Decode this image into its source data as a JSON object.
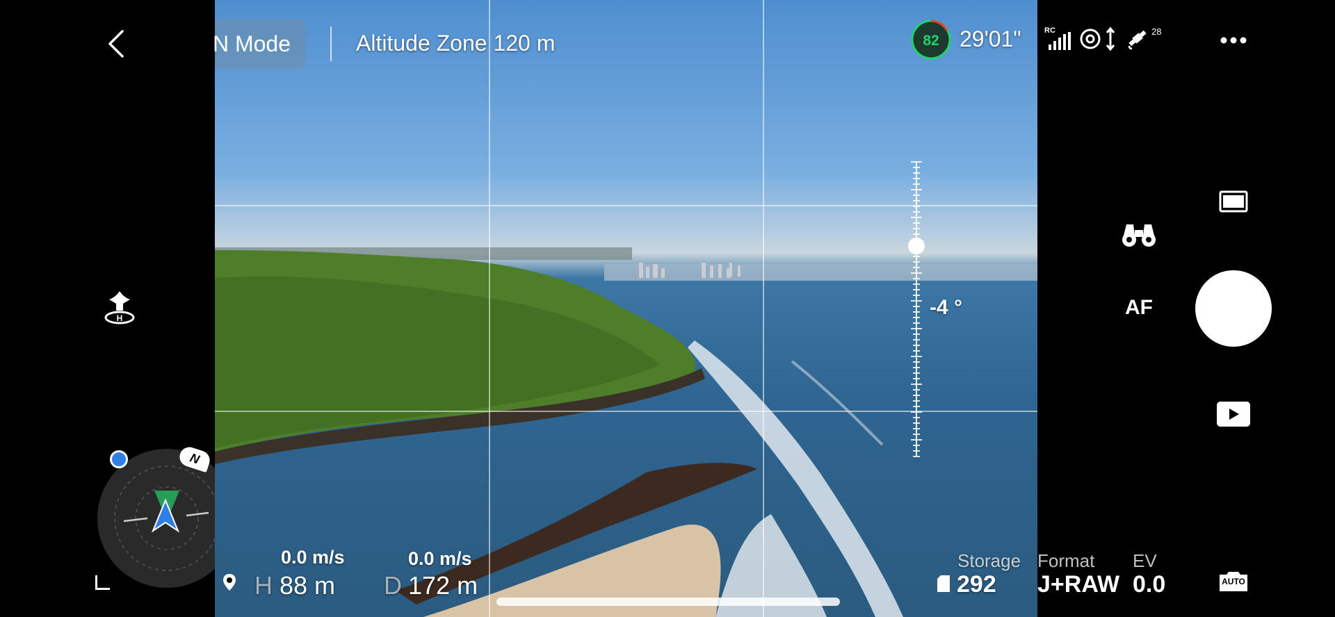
{
  "top_bar": {
    "mode_label": "N Mode",
    "altitude_zone": "Altitude Zone 120 m",
    "battery_percent": "82",
    "flight_time": "29'01\"",
    "rc_label": "RC",
    "satellite_count": "28"
  },
  "gimbal": {
    "angle_label": "-4 °"
  },
  "right_controls": {
    "af_label": "AF",
    "auto_label": "AUTO"
  },
  "telemetry": {
    "vertical_speed": "0.0 m/s",
    "horizontal_speed": "0.0 m/s",
    "height_prefix": "H",
    "height_value": "88 m",
    "distance_prefix": "D",
    "distance_value": "172 m"
  },
  "camera_info": {
    "storage_label": "Storage",
    "storage_value": "292",
    "format_label": "Format",
    "format_value": "J+RAW",
    "ev_label": "EV",
    "ev_value": "0.0"
  },
  "compass": {
    "north_label": "N"
  },
  "colors": {
    "battery_ring": "#1fd36b",
    "battery_warn": "#e8432e",
    "nav_arrow": "#2f7fe6",
    "nav_beam": "#27c46a"
  },
  "icons": [
    "back-icon",
    "more-icon",
    "takeoff-icon",
    "binoculars-icon",
    "shutter-button",
    "playback-icon",
    "aspect-ratio-icon",
    "auto-camera-icon",
    "map-pin-icon",
    "storage-card-icon",
    "signal-icon",
    "obstacle-sensing-icon",
    "gps-icon",
    "corner-icon"
  ]
}
